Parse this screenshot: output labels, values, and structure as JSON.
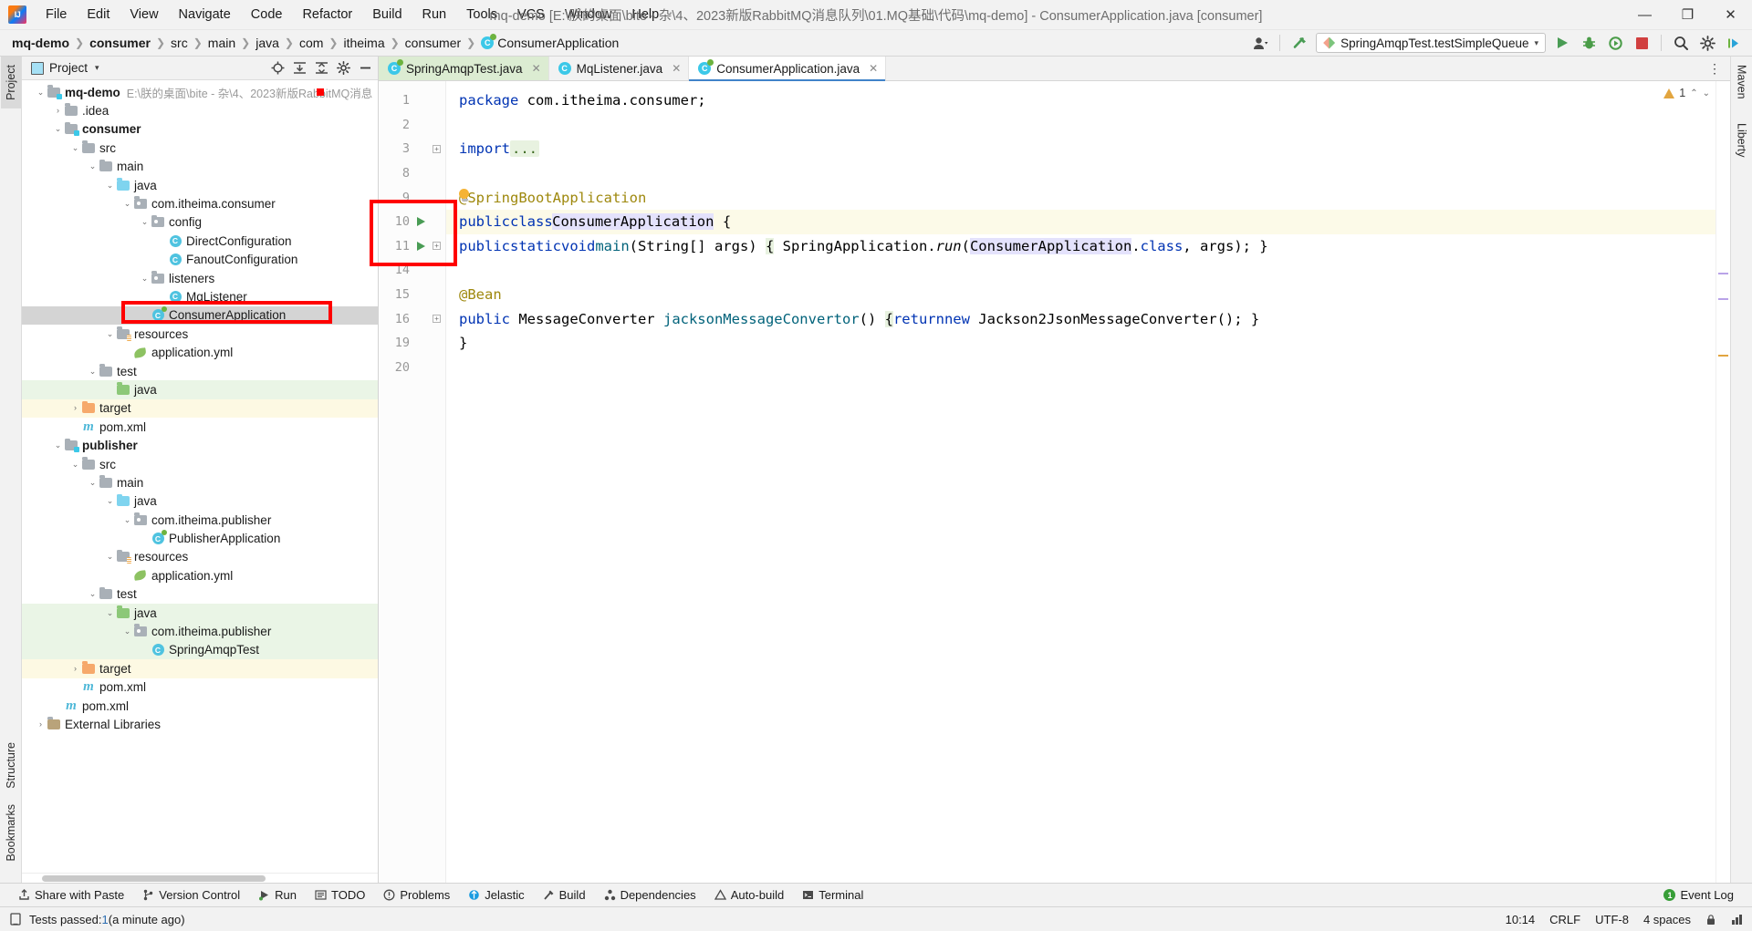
{
  "window": {
    "title": "mq-demo [E:\\朕的桌面\\bite - 杂\\4、2023新版RabbitMQ消息队列\\01.MQ基础\\代码\\mq-demo] - ConsumerApplication.java [consumer]",
    "minimize": "—",
    "maximize": "❐",
    "close": "✕"
  },
  "menubar": [
    {
      "label": "File"
    },
    {
      "label": "Edit"
    },
    {
      "label": "View"
    },
    {
      "label": "Navigate"
    },
    {
      "label": "Code"
    },
    {
      "label": "Refactor"
    },
    {
      "label": "Build"
    },
    {
      "label": "Run"
    },
    {
      "label": "Tools"
    },
    {
      "label": "VCS"
    },
    {
      "label": "Window"
    },
    {
      "label": "Help"
    }
  ],
  "breadcrumb": {
    "separator": "❯",
    "items": [
      {
        "label": "mq-demo",
        "bold": true,
        "icon": null
      },
      {
        "label": "consumer",
        "bold": true,
        "icon": null
      },
      {
        "label": "src",
        "bold": false,
        "icon": null
      },
      {
        "label": "main",
        "bold": false,
        "icon": null
      },
      {
        "label": "java",
        "bold": false,
        "icon": null
      },
      {
        "label": "com",
        "bold": false,
        "icon": null
      },
      {
        "label": "itheima",
        "bold": false,
        "icon": null
      },
      {
        "label": "consumer",
        "bold": false,
        "icon": null
      },
      {
        "label": "ConsumerApplication",
        "bold": false,
        "icon": "class-spring-icon"
      }
    ]
  },
  "toolbar": {
    "run_config": "SpringAmqpTest.testSimpleQueue",
    "run_config_caret": "▾",
    "user_icon": "user-icon",
    "user_caret": "▾",
    "hammer_icon": "build-hammer-icon",
    "run_icon": "run-icon",
    "debug_icon": "debug-icon",
    "coverage_icon": "run-with-coverage-icon",
    "stop_icon": "stop-icon",
    "search_icon": "search-everywhere-icon",
    "settings_icon": "settings-gear-icon",
    "updates_icon": "ide-update-icon"
  },
  "left_stripe": {
    "tabs": [
      {
        "label": "Project",
        "active": true
      },
      {
        "label": "Structure",
        "active": false
      },
      {
        "label": "Bookmarks",
        "active": false
      }
    ]
  },
  "right_stripe": {
    "tabs": [
      {
        "label": "Maven",
        "active": false
      },
      {
        "label": "Liberty",
        "active": false
      }
    ]
  },
  "project_panel": {
    "title": "Project",
    "caret": "▾",
    "actions": [
      "locate-target-icon",
      "expand-all-icon",
      "collapse-all-icon",
      "settings-gear-icon",
      "hide-icon"
    ],
    "tree": [
      {
        "depth": 0,
        "arrow": "v",
        "icon": "module-folder",
        "label": "mq-demo",
        "bold": true,
        "sub": "E:\\朕的桌面\\bite - 杂\\4、2023新版RabbitMQ消息",
        "row": "normal"
      },
      {
        "depth": 1,
        "arrow": ">",
        "icon": "folder",
        "label": ".idea",
        "bold": false,
        "sub": "",
        "row": "normal"
      },
      {
        "depth": 1,
        "arrow": "v",
        "icon": "module-folder",
        "label": "consumer",
        "bold": true,
        "sub": "",
        "row": "normal"
      },
      {
        "depth": 2,
        "arrow": "v",
        "icon": "folder",
        "label": "src",
        "bold": false,
        "sub": "",
        "row": "normal"
      },
      {
        "depth": 3,
        "arrow": "v",
        "icon": "folder",
        "label": "main",
        "bold": false,
        "sub": "",
        "row": "normal"
      },
      {
        "depth": 4,
        "arrow": "v",
        "icon": "folder-blue",
        "label": "java",
        "bold": false,
        "sub": "",
        "row": "normal"
      },
      {
        "depth": 5,
        "arrow": "v",
        "icon": "package",
        "label": "com.itheima.consumer",
        "bold": false,
        "sub": "",
        "row": "normal"
      },
      {
        "depth": 6,
        "arrow": "v",
        "icon": "package",
        "label": "config",
        "bold": false,
        "sub": "",
        "row": "normal"
      },
      {
        "depth": 7,
        "arrow": "",
        "icon": "class",
        "label": "DirectConfiguration",
        "bold": false,
        "sub": "",
        "row": "normal"
      },
      {
        "depth": 7,
        "arrow": "",
        "icon": "class",
        "label": "FanoutConfiguration",
        "bold": false,
        "sub": "",
        "row": "normal"
      },
      {
        "depth": 6,
        "arrow": "v",
        "icon": "package",
        "label": "listeners",
        "bold": false,
        "sub": "",
        "row": "normal"
      },
      {
        "depth": 7,
        "arrow": "",
        "icon": "class",
        "label": "MqListener",
        "bold": false,
        "sub": "",
        "row": "normal"
      },
      {
        "depth": 6,
        "arrow": "",
        "icon": "class-spring",
        "label": "ConsumerApplication",
        "bold": false,
        "sub": "",
        "row": "selected"
      },
      {
        "depth": 4,
        "arrow": "v",
        "icon": "folder-res",
        "label": "resources",
        "bold": false,
        "sub": "",
        "row": "normal"
      },
      {
        "depth": 5,
        "arrow": "",
        "icon": "yml",
        "label": "application.yml",
        "bold": false,
        "sub": "",
        "row": "normal"
      },
      {
        "depth": 3,
        "arrow": "v",
        "icon": "folder",
        "label": "test",
        "bold": false,
        "sub": "",
        "row": "normal"
      },
      {
        "depth": 4,
        "arrow": "",
        "icon": "folder-green",
        "label": "java",
        "bold": false,
        "sub": "",
        "row": "green"
      },
      {
        "depth": 2,
        "arrow": ">",
        "icon": "folder-orange",
        "label": "target",
        "bold": false,
        "sub": "",
        "row": "yellow"
      },
      {
        "depth": 2,
        "arrow": "",
        "icon": "maven",
        "label": "pom.xml",
        "bold": false,
        "sub": "",
        "row": "normal"
      },
      {
        "depth": 1,
        "arrow": "v",
        "icon": "module-folder",
        "label": "publisher",
        "bold": true,
        "sub": "",
        "row": "normal"
      },
      {
        "depth": 2,
        "arrow": "v",
        "icon": "folder",
        "label": "src",
        "bold": false,
        "sub": "",
        "row": "normal"
      },
      {
        "depth": 3,
        "arrow": "v",
        "icon": "folder",
        "label": "main",
        "bold": false,
        "sub": "",
        "row": "normal"
      },
      {
        "depth": 4,
        "arrow": "v",
        "icon": "folder-blue",
        "label": "java",
        "bold": false,
        "sub": "",
        "row": "normal"
      },
      {
        "depth": 5,
        "arrow": "v",
        "icon": "package",
        "label": "com.itheima.publisher",
        "bold": false,
        "sub": "",
        "row": "normal"
      },
      {
        "depth": 6,
        "arrow": "",
        "icon": "class-spring",
        "label": "PublisherApplication",
        "bold": false,
        "sub": "",
        "row": "normal"
      },
      {
        "depth": 4,
        "arrow": "v",
        "icon": "folder-res",
        "label": "resources",
        "bold": false,
        "sub": "",
        "row": "normal"
      },
      {
        "depth": 5,
        "arrow": "",
        "icon": "yml",
        "label": "application.yml",
        "bold": false,
        "sub": "",
        "row": "normal"
      },
      {
        "depth": 3,
        "arrow": "v",
        "icon": "folder",
        "label": "test",
        "bold": false,
        "sub": "",
        "row": "normal"
      },
      {
        "depth": 4,
        "arrow": "v",
        "icon": "folder-green",
        "label": "java",
        "bold": false,
        "sub": "",
        "row": "green"
      },
      {
        "depth": 5,
        "arrow": "v",
        "icon": "package",
        "label": "com.itheima.publisher",
        "bold": false,
        "sub": "",
        "row": "green"
      },
      {
        "depth": 6,
        "arrow": "",
        "icon": "class",
        "label": "SpringAmqpTest",
        "bold": false,
        "sub": "",
        "row": "green"
      },
      {
        "depth": 2,
        "arrow": ">",
        "icon": "folder-orange",
        "label": "target",
        "bold": false,
        "sub": "",
        "row": "yellow"
      },
      {
        "depth": 2,
        "arrow": "",
        "icon": "maven",
        "label": "pom.xml",
        "bold": false,
        "sub": "",
        "row": "normal"
      },
      {
        "depth": 1,
        "arrow": "",
        "icon": "maven",
        "label": "pom.xml",
        "bold": false,
        "sub": "",
        "row": "normal"
      },
      {
        "depth": 0,
        "arrow": ">",
        "icon": "library",
        "label": "External Libraries",
        "bold": false,
        "sub": "",
        "row": "normal"
      }
    ]
  },
  "editor": {
    "tabs": [
      {
        "label": "SpringAmqpTest.java",
        "icon": "class-icon",
        "state": "green",
        "close": "✕"
      },
      {
        "label": "MqListener.java",
        "icon": "class-icon",
        "state": "plain",
        "close": "✕"
      },
      {
        "label": "ConsumerApplication.java",
        "icon": "class-spring-icon",
        "state": "active",
        "close": "✕"
      }
    ],
    "kebab": "⋮",
    "inspections": {
      "warning_count": "1",
      "icon": "warning-triangle-icon",
      "up": "⌃",
      "down": "⌄"
    },
    "lines": [
      {
        "num": "1",
        "runmark": false,
        "fold": "",
        "highlight": false,
        "text": "package com.itheima.consumer;"
      },
      {
        "num": "2",
        "runmark": false,
        "fold": "",
        "highlight": false,
        "text": ""
      },
      {
        "num": "3",
        "runmark": false,
        "fold": "+",
        "highlight": false,
        "text": "import ..."
      },
      {
        "num": "8",
        "runmark": false,
        "fold": "",
        "highlight": false,
        "text": ""
      },
      {
        "num": "9",
        "runmark": false,
        "fold": "",
        "highlight": false,
        "text": "@SpringBootApplication"
      },
      {
        "num": "10",
        "runmark": true,
        "fold": "",
        "highlight": true,
        "text": "public class ConsumerApplication {"
      },
      {
        "num": "11",
        "runmark": true,
        "fold": "+",
        "highlight": false,
        "text": "    public static void main(String[] args) { SpringApplication.run(ConsumerApplication.class, args); }"
      },
      {
        "num": "14",
        "runmark": false,
        "fold": "",
        "highlight": false,
        "text": ""
      },
      {
        "num": "15",
        "runmark": false,
        "fold": "",
        "highlight": false,
        "text": "    @Bean"
      },
      {
        "num": "16",
        "runmark": false,
        "fold": "+",
        "highlight": false,
        "text": "    public MessageConverter jacksonMessageConvertor() { return new Jackson2JsonMessageConverter(); }"
      },
      {
        "num": "19",
        "runmark": false,
        "fold": "",
        "highlight": false,
        "text": "}"
      },
      {
        "num": "20",
        "runmark": false,
        "fold": "",
        "highlight": false,
        "text": ""
      }
    ]
  },
  "tool_window_bar": {
    "items": [
      {
        "label": "Share with Paste",
        "icon": "share-icon"
      },
      {
        "label": "Version Control",
        "icon": "branch-icon"
      },
      {
        "label": "Run",
        "icon": "run-icon"
      },
      {
        "label": "TODO",
        "icon": "todo-icon"
      },
      {
        "label": "Problems",
        "icon": "problems-icon"
      },
      {
        "label": "Jelastic",
        "icon": "jelastic-icon"
      },
      {
        "label": "Build",
        "icon": "build-icon"
      },
      {
        "label": "Dependencies",
        "icon": "dependencies-icon"
      },
      {
        "label": "Auto-build",
        "icon": "autobuild-icon"
      },
      {
        "label": "Terminal",
        "icon": "terminal-icon"
      }
    ],
    "event_log": {
      "label": "Event Log",
      "badge": "1"
    }
  },
  "status_bar": {
    "message_prefix": "Tests passed: ",
    "message_count": "1",
    "message_suffix": " (a minute ago)",
    "icon": "test-results-icon",
    "position": "10:14",
    "line_separator": "CRLF",
    "encoding": "UTF-8",
    "indent": "4 spaces",
    "lock_icon": "lock-icon",
    "memory_icon": "memory-indicator-icon"
  },
  "colors": {
    "accent_blue": "#4083c9",
    "spring_green": "#6db33f",
    "class_blue": "#4fc3e0",
    "keyword": "#0033b3",
    "annotation": "#9e880d",
    "method": "#00627a",
    "redbox": "#ff0000",
    "selection": "#e4e2fc",
    "highlight_line": "#fcfae8"
  }
}
